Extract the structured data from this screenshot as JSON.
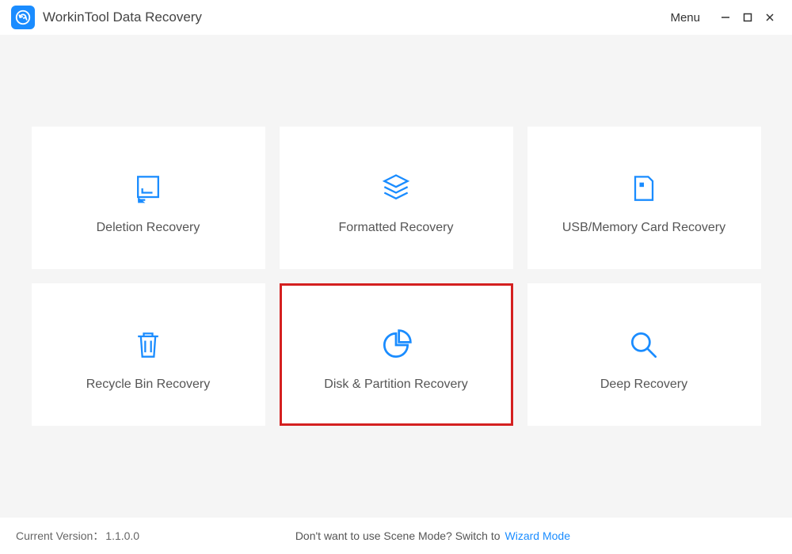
{
  "app": {
    "title": "WorkinTool Data Recovery",
    "menu_label": "Menu"
  },
  "cards": {
    "deletion": {
      "label": "Deletion Recovery"
    },
    "formatted": {
      "label": "Formatted Recovery"
    },
    "usb": {
      "label": "USB/Memory Card Recovery"
    },
    "recycle": {
      "label": "Recycle Bin Recovery"
    },
    "disk": {
      "label": "Disk & Partition Recovery"
    },
    "deep": {
      "label": "Deep Recovery"
    }
  },
  "footer": {
    "version_label": "Current Version",
    "version_value": "1.1.0.0",
    "switch_prompt": "Don't want to use Scene Mode? Switch to",
    "wizard_link": "Wizard Mode"
  },
  "colors": {
    "accent": "#1a8cff",
    "highlight": "#d42020"
  }
}
